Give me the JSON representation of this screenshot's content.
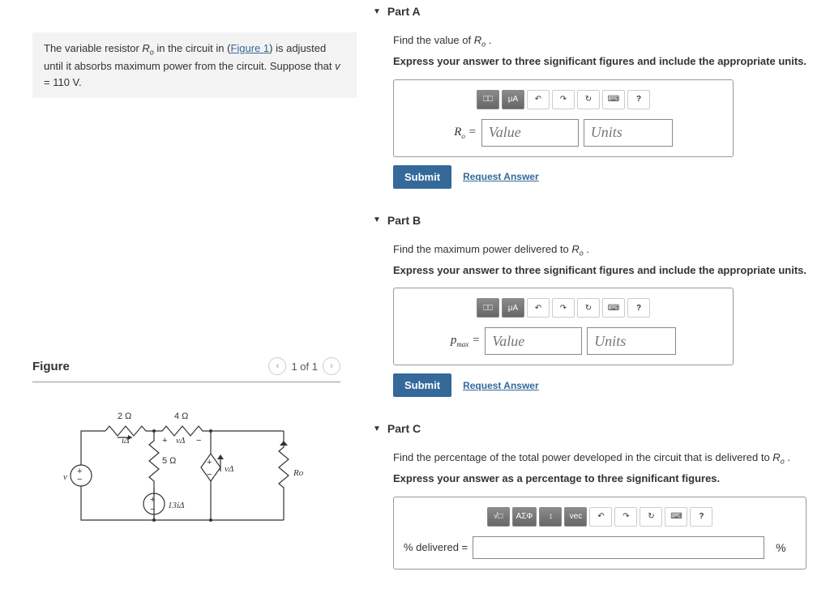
{
  "problem": {
    "text_pre": "The variable resistor ",
    "var": "R",
    "sub": "o",
    "text_mid": " in the circuit in (",
    "fig_link": "Figure 1",
    "text_after_link": ") is adjusted until it absorbs maximum power from the circuit. Suppose that ",
    "vvar": "v",
    "eq": " = 110 V."
  },
  "figure": {
    "title": "Figure",
    "pager": "1 of 1",
    "labels": {
      "r1": "2 Ω",
      "r2": "4 Ω",
      "r3": "5 Ω",
      "iD": "iΔ",
      "vD": "vΔ",
      "v": "v",
      "ccvs": "13iΔ",
      "Ro": "Ro",
      "vDpol_p": "+ ",
      "vDpol_n": " −"
    }
  },
  "parts": {
    "A": {
      "header": "Part A",
      "instr": "Find the value of ",
      "var": "R",
      "sub": "o",
      "period": " .",
      "bold": "Express your answer to three significant figures and include the appropriate units.",
      "lhs": "Ro",
      "eq": " = ",
      "value_ph": "Value",
      "units_ph": "Units",
      "submit": "Submit",
      "req": "Request Answer"
    },
    "B": {
      "header": "Part B",
      "instr": "Find the maximum power delivered to ",
      "var": "R",
      "sub": "o",
      "period": " .",
      "bold": "Express your answer to three significant figures and include the appropriate units.",
      "lhs": "pmax",
      "eq": " = ",
      "value_ph": "Value",
      "units_ph": "Units",
      "submit": "Submit",
      "req": "Request Answer"
    },
    "C": {
      "header": "Part C",
      "instr": "Find the percentage of the total power developed in the circuit that is delivered to ",
      "var": "R",
      "sub": "o",
      "period": " .",
      "bold": "Express your answer as a percentage to three significant figures.",
      "lhs": "% delivered =",
      "unit": "%"
    }
  },
  "toolbar": {
    "template": "⎕⎕",
    "muA": "μA",
    "undo": "↶",
    "redo": "↷",
    "reset": "↻",
    "keyboard": "⌨",
    "help": "?",
    "sqrt": "√□",
    "greek": "ΑΣΦ",
    "subsup": "↕",
    "vec": "vec"
  }
}
